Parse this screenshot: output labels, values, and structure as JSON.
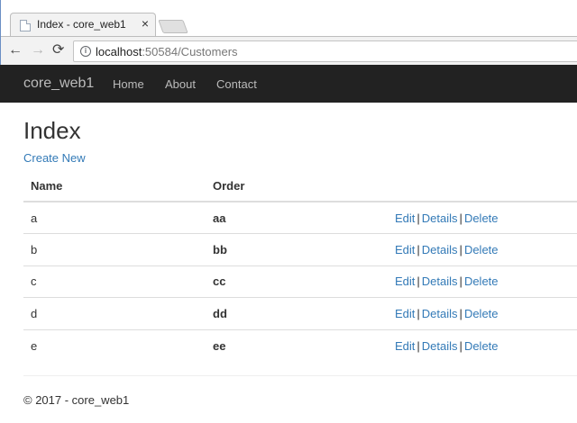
{
  "browser": {
    "tab_title": "Index - core_web1",
    "tab_close": "×",
    "url_host": "localhost",
    "url_rest": ":50584/Customers",
    "back_glyph": "←",
    "forward_glyph": "→",
    "reload_glyph": "⟳",
    "info_glyph": "i"
  },
  "navbar": {
    "brand": "core_web1",
    "links": [
      "Home",
      "About",
      "Contact"
    ]
  },
  "main": {
    "title": "Index",
    "create_new": "Create New",
    "table": {
      "headers": [
        "Name",
        "Order",
        ""
      ],
      "rows": [
        {
          "name": "a",
          "order": "aa"
        },
        {
          "name": "b",
          "order": "bb"
        },
        {
          "name": "c",
          "order": "cc"
        },
        {
          "name": "d",
          "order": "dd"
        },
        {
          "name": "e",
          "order": "ee"
        }
      ],
      "actions": {
        "edit": "Edit",
        "details": "Details",
        "delete": "Delete",
        "separator": "|"
      }
    }
  },
  "footer": {
    "text": "© 2017 - core_web1"
  },
  "colors": {
    "navbar_bg": "#222222",
    "link": "#337ab7",
    "nav_text": "#bbbbbb"
  }
}
